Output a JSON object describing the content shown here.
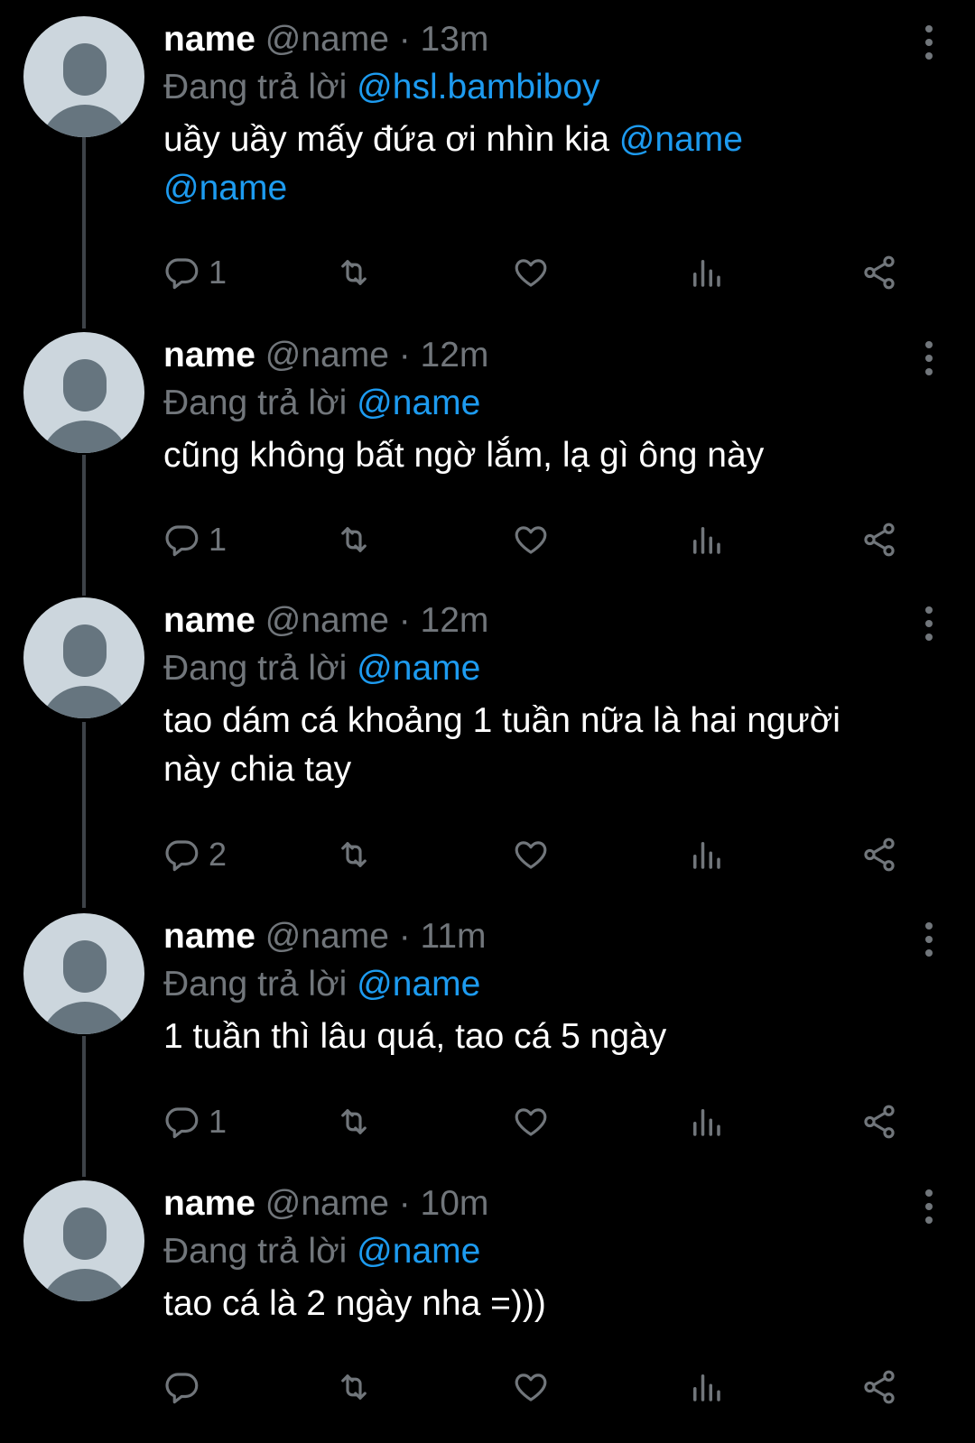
{
  "tweets": [
    {
      "name": "name",
      "handle_time": "@name · 13m",
      "reply_prefix": "Đang trả lời",
      "reply_to": "@hsl.bambiboy",
      "text_a": "uầy uầy mấy đứa ơi nhìn kia ",
      "mention_a": "@name",
      "mention_b": "@name",
      "replies": "1"
    },
    {
      "name": "name",
      "handle_time": "@name · 12m",
      "reply_prefix": "Đang trả lời",
      "reply_to": "@name",
      "text": "cũng không bất ngờ lắm, lạ gì ông này",
      "replies": "1"
    },
    {
      "name": "name",
      "handle_time": "@name · 12m",
      "reply_prefix": "Đang trả lời",
      "reply_to": "@name",
      "text": "tao dám cá khoảng 1 tuần nữa là hai người này chia tay",
      "replies": "2"
    },
    {
      "name": "name",
      "handle_time": "@name · 11m",
      "reply_prefix": "Đang trả lời",
      "reply_to": "@name",
      "text": "1 tuần thì lâu quá, tao cá 5 ngày",
      "replies": "1"
    },
    {
      "name": "name",
      "handle_time": "@name · 10m",
      "reply_prefix": "Đang trả lời",
      "reply_to": "@name",
      "text": "tao cá là 2 ngày nha =)))",
      "replies": ""
    }
  ],
  "icons": {
    "reply": "reply-icon",
    "retweet": "retweet-icon",
    "like": "heart-icon",
    "views": "views-icon",
    "share": "share-icon",
    "more": "more-vertical-icon",
    "avatar": "default-avatar"
  },
  "colors": {
    "background": "#000000",
    "text": "#ffffff",
    "muted": "#71767b",
    "mention": "#1d9bf0",
    "avatar_bg": "#ccd6dd",
    "avatar_fg": "#66757f"
  }
}
